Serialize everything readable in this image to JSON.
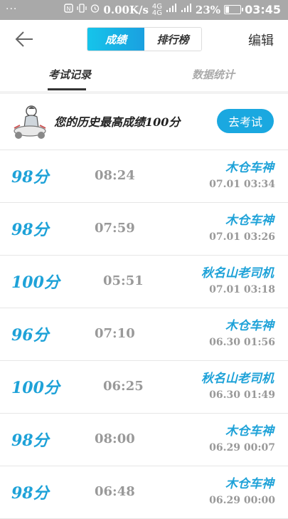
{
  "status_bar": {
    "dots": "···",
    "speed": "0.00K/s",
    "net_type": "4G 4G",
    "battery_pct": "23%",
    "time": "03:45",
    "icons": [
      "nfc-icon",
      "vibrate-icon",
      "alarm-icon",
      "signal-icon",
      "battery-icon"
    ]
  },
  "header": {
    "back_icon": "back-arrow-icon",
    "seg_tabs": [
      "成绩",
      "排行榜"
    ],
    "active_seg": 0,
    "edit_label": "编辑"
  },
  "tabs": {
    "items": [
      "考试记录",
      "数据统计"
    ],
    "active": 0
  },
  "banner": {
    "text": "您的历史最高成绩100分",
    "button": "去考试"
  },
  "records": [
    {
      "score": "98分",
      "duration": "08:24",
      "name": "木仓车神",
      "date": "07.01  03:34"
    },
    {
      "score": "98分",
      "duration": "07:59",
      "name": "木仓车神",
      "date": "07.01  03:26"
    },
    {
      "score": "100分",
      "duration": "05:51",
      "name": "秋名山老司机",
      "date": "07.01  03:18"
    },
    {
      "score": "96分",
      "duration": "07:10",
      "name": "木仓车神",
      "date": "06.30  01:56"
    },
    {
      "score": "100分",
      "duration": "06:25",
      "name": "秋名山老司机",
      "date": "06.30  01:49"
    },
    {
      "score": "98分",
      "duration": "08:00",
      "name": "木仓车神",
      "date": "06.29  00:07"
    },
    {
      "score": "98分",
      "duration": "06:48",
      "name": "木仓车神",
      "date": "06.29  00:00"
    }
  ],
  "colors": {
    "accent": "#1ea2d8",
    "status_bar": "#a9a9a9",
    "muted": "#999999"
  }
}
